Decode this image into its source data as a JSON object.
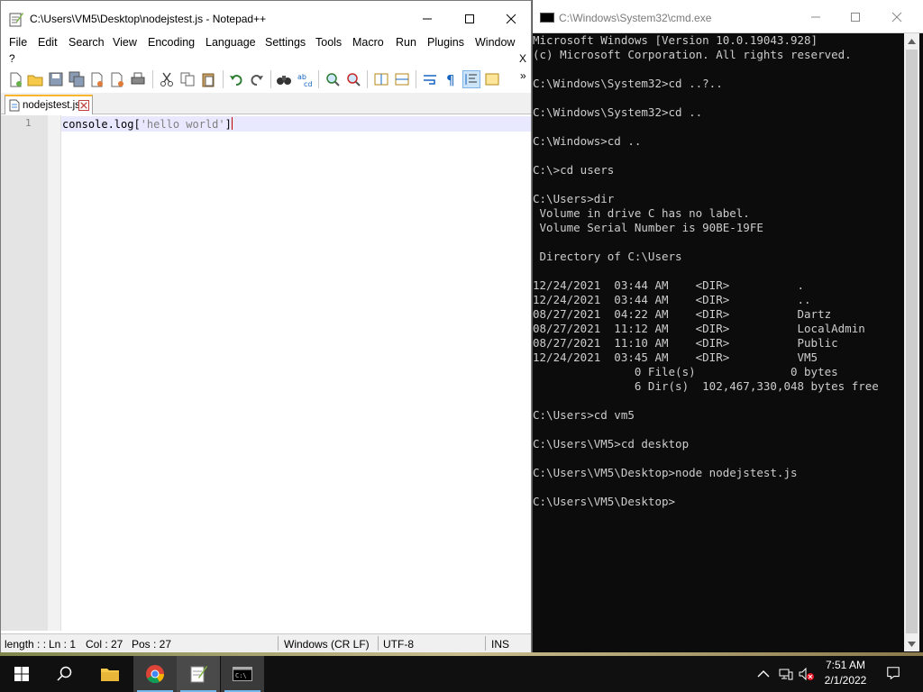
{
  "npp": {
    "title": "C:\\Users\\VM5\\Desktop\\nodejstest.js - Notepad++",
    "menu": [
      "File",
      "Edit",
      "Search",
      "View",
      "Encoding",
      "Language",
      "Settings",
      "Tools",
      "Macro",
      "Run",
      "Plugins",
      "Window"
    ],
    "help_menu": "?",
    "close_doc": "X",
    "toolbar_more": "»",
    "tab": {
      "label": "nodejstest.js"
    },
    "editor": {
      "line_number": "1",
      "code_prefix": "console.log[",
      "code_string": "'hello world'",
      "code_suffix": "]"
    },
    "status": {
      "length": "length : :",
      "ln": "Ln : 1",
      "col": "Col : 27",
      "pos": "Pos : 27",
      "eol": "Windows (CR LF)",
      "encoding": "UTF-8",
      "mode": "INS"
    }
  },
  "cmd": {
    "title": "C:\\Windows\\System32\\cmd.exe",
    "lines": [
      "Microsoft Windows [Version 10.0.19043.928]",
      "(c) Microsoft Corporation. All rights reserved.",
      "",
      "C:\\Windows\\System32>cd ..?..",
      "",
      "C:\\Windows\\System32>cd ..",
      "",
      "C:\\Windows>cd ..",
      "",
      "C:\\>cd users",
      "",
      "C:\\Users>dir",
      " Volume in drive C has no label.",
      " Volume Serial Number is 90BE-19FE",
      "",
      " Directory of C:\\Users",
      "",
      "12/24/2021  03:44 AM    <DIR>          .",
      "12/24/2021  03:44 AM    <DIR>          ..",
      "08/27/2021  04:22 AM    <DIR>          Dartz",
      "08/27/2021  11:12 AM    <DIR>          LocalAdmin",
      "08/27/2021  11:10 AM    <DIR>          Public",
      "12/24/2021  03:45 AM    <DIR>          VM5",
      "               0 File(s)              0 bytes",
      "               6 Dir(s)  102,467,330,048 bytes free",
      "",
      "C:\\Users>cd vm5",
      "",
      "C:\\Users\\VM5>cd desktop",
      "",
      "C:\\Users\\VM5\\Desktop>node nodejstest.js",
      "",
      "C:\\Users\\VM5\\Desktop>"
    ]
  },
  "taskbar": {
    "apps": [
      "start-icon",
      "search-icon",
      "file-explorer-icon",
      "chrome-icon",
      "notepadpp-icon",
      "cmd-icon"
    ],
    "time": "7:51 AM",
    "date": "2/1/2022"
  },
  "colors": {
    "accent": "#76b9ed",
    "tab_highlight": "#fab62e",
    "console_bg": "#0c0c0c",
    "console_fg": "#cccccc"
  }
}
